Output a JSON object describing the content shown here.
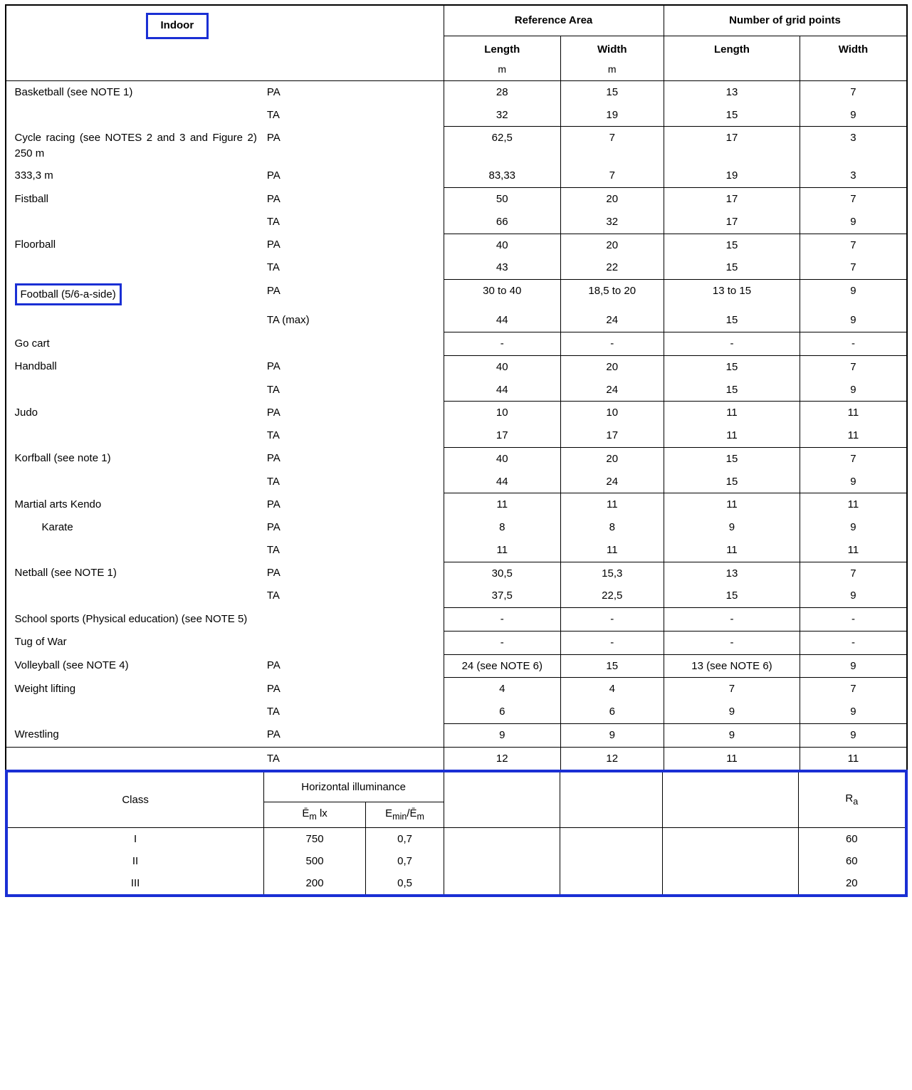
{
  "header": {
    "indoor": "Indoor",
    "refArea": "Reference Area",
    "gridPts": "Number of grid points",
    "length": "Length",
    "width": "Width",
    "unit_m": "m"
  },
  "rows": [
    {
      "sport": "Basketball (see NOTE 1)",
      "type": "PA",
      "refL": "28",
      "refW": "15",
      "gL": "13",
      "gW": "7"
    },
    {
      "sport": "",
      "type": "TA",
      "refL": "32",
      "refW": "19",
      "gL": "15",
      "gW": "9",
      "botNum": true
    },
    {
      "sport": "Cycle racing (see NOTES 2 and 3 and Figure 2) 250 m",
      "type": "PA",
      "refL": "62,5",
      "refW": "7",
      "gL": "17",
      "gW": "3"
    },
    {
      "sport": "333,3 m",
      "type": "PA",
      "refL": "83,33",
      "refW": "7",
      "gL": "19",
      "gW": "3",
      "botNum": true
    },
    {
      "sport": "Fistball",
      "type": "PA",
      "refL": "50",
      "refW": "20",
      "gL": "17",
      "gW": "7"
    },
    {
      "sport": "",
      "type": "TA",
      "refL": "66",
      "refW": "32",
      "gL": "17",
      "gW": "9",
      "botNum": true
    },
    {
      "sport": "Floorball",
      "type": "PA",
      "refL": "40",
      "refW": "20",
      "gL": "15",
      "gW": "7"
    },
    {
      "sport": "",
      "type": "TA",
      "refL": "43",
      "refW": "22",
      "gL": "15",
      "gW": "7",
      "botNum": true
    },
    {
      "sport": "Football (5/6-a-side)",
      "type": "PA",
      "refL": "30 to 40",
      "refW": "18,5 to 20",
      "gL": "13 to 15",
      "gW": "9",
      "hl": true
    },
    {
      "sport": "",
      "type": "TA (max)",
      "refL": "44",
      "refW": "24",
      "gL": "15",
      "gW": "9",
      "botNum": true
    },
    {
      "sport": "Go cart",
      "type": "",
      "refL": "-",
      "refW": "-",
      "gL": "-",
      "gW": "-",
      "botNum": true
    },
    {
      "sport": "Handball",
      "type": "PA",
      "refL": "40",
      "refW": "20",
      "gL": "15",
      "gW": "7"
    },
    {
      "sport": "",
      "type": "TA",
      "refL": "44",
      "refW": "24",
      "gL": "15",
      "gW": "9",
      "botNum": true
    },
    {
      "sport": "Judo",
      "type": "PA",
      "refL": "10",
      "refW": "10",
      "gL": "11",
      "gW": "11"
    },
    {
      "sport": "",
      "type": "TA",
      "refL": "17",
      "refW": "17",
      "gL": "11",
      "gW": "11",
      "botNum": true
    },
    {
      "sport": "Korfball (see note 1)",
      "type": "PA",
      "refL": "40",
      "refW": "20",
      "gL": "15",
      "gW": "7"
    },
    {
      "sport": "",
      "type": "TA",
      "refL": "44",
      "refW": "24",
      "gL": "15",
      "gW": "9",
      "botNum": true
    },
    {
      "sport": "Martial arts Kendo",
      "type": "PA",
      "refL": "11",
      "refW": "11",
      "gL": "11",
      "gW": "11"
    },
    {
      "sport": "Karate",
      "type": "PA",
      "refL": "8",
      "refW": "8",
      "gL": "9",
      "gW": "9",
      "indent": true
    },
    {
      "sport": "",
      "type": "TA",
      "refL": "11",
      "refW": "11",
      "gL": "11",
      "gW": "11",
      "botNum": true
    },
    {
      "sport": "Netball (see NOTE 1)",
      "type": "PA",
      "refL": "30,5",
      "refW": "15,3",
      "gL": "13",
      "gW": "7"
    },
    {
      "sport": "",
      "type": "TA",
      "refL": "37,5",
      "refW": "22,5",
      "gL": "15",
      "gW": "9",
      "botNum": true
    },
    {
      "sport": "School sports (Physical education) (see NOTE 5)",
      "type": "",
      "refL": "-",
      "refW": "-",
      "gL": "-",
      "gW": "-",
      "botNum": true
    },
    {
      "sport": "Tug of War",
      "type": "",
      "refL": "-",
      "refW": "-",
      "gL": "-",
      "gW": "-",
      "botNum": true
    },
    {
      "sport": "Volleyball (see NOTE 4)",
      "type": "PA",
      "refL": "24 (see NOTE 6)",
      "refW": "15",
      "gL": "13 (see NOTE 6)",
      "gW": "9",
      "botNum": true
    },
    {
      "sport": "Weight lifting",
      "type": "PA",
      "refL": "4",
      "refW": "4",
      "gL": "7",
      "gW": "7"
    },
    {
      "sport": "",
      "type": "TA",
      "refL": "6",
      "refW": "6",
      "gL": "9",
      "gW": "9",
      "botNum": true
    },
    {
      "sport": "Wrestling",
      "type": "PA",
      "refL": "9",
      "refW": "9",
      "gL": "9",
      "gW": "9",
      "botNum": true,
      "botSport": true
    },
    {
      "sport": "",
      "type": "TA",
      "refL": "12",
      "refW": "12",
      "gL": "11",
      "gW": "11"
    }
  ],
  "class": {
    "title": "Class",
    "hillum": "Horizontal illuminance",
    "em": "Ē",
    "em_sub": "m",
    "lx": " lx",
    "emin": "E",
    "emin_sub": "min",
    "slash": "/Ē",
    "ra": "R",
    "ra_sub": "a",
    "rows": [
      {
        "cls": "I",
        "em": "750",
        "emin": "0,7",
        "ra": "60"
      },
      {
        "cls": "II",
        "em": "500",
        "emin": "0,7",
        "ra": "60"
      },
      {
        "cls": "III",
        "em": "200",
        "emin": "0,5",
        "ra": "20"
      }
    ]
  }
}
